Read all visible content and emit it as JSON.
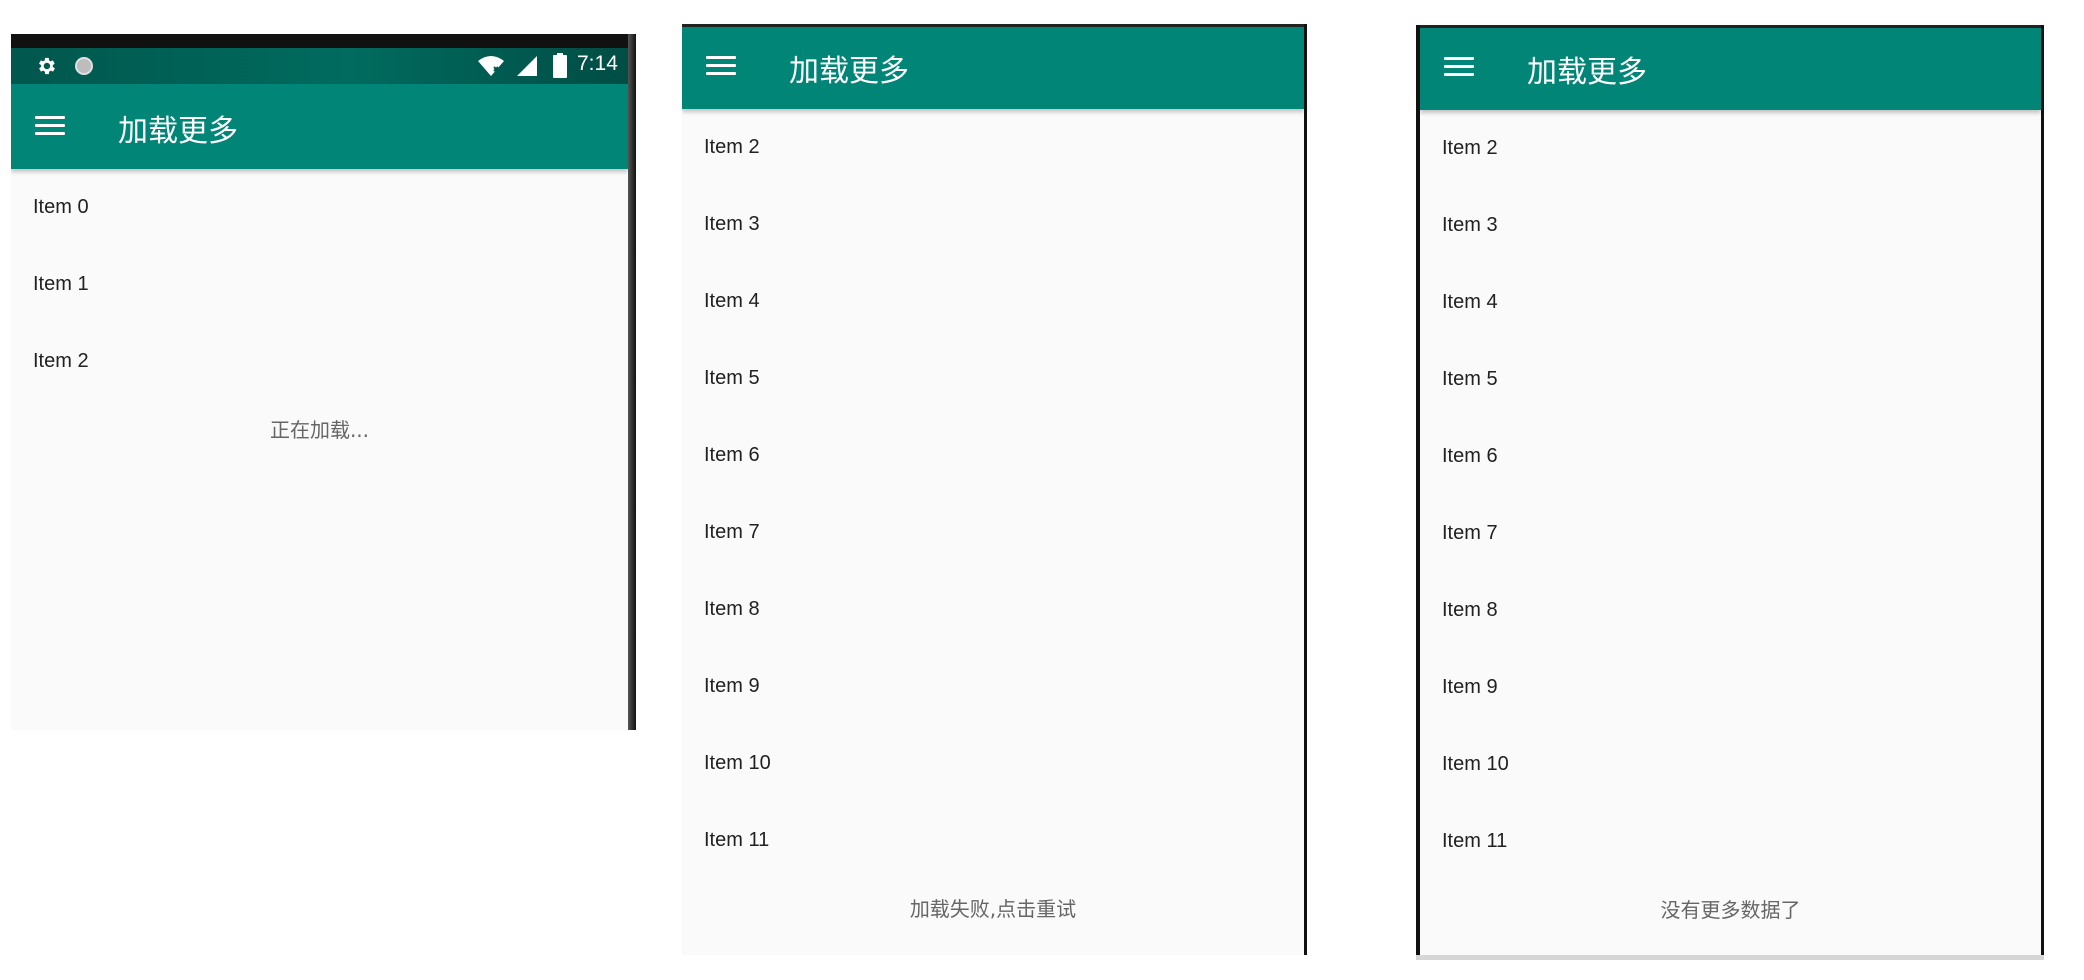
{
  "colors": {
    "primary": "#008577",
    "status_bar": "#00574d",
    "background": "#fafafa",
    "text_primary": "#212121",
    "text_secondary": "#666666"
  },
  "status_bar": {
    "time": "7:14",
    "icons": [
      "gear-icon",
      "circle-notification-icon",
      "wifi-icon",
      "signal-icon",
      "battery-icon"
    ]
  },
  "panels": [
    {
      "toolbar_title": "加载更多",
      "menu_icon": "hamburger-menu-icon",
      "items": [
        "Item 0",
        "Item 1",
        "Item 2"
      ],
      "footer": "正在加载..."
    },
    {
      "toolbar_title": "加载更多",
      "menu_icon": "hamburger-menu-icon",
      "items": [
        "Item 2",
        "Item 3",
        "Item 4",
        "Item 5",
        "Item 6",
        "Item 7",
        "Item 8",
        "Item 9",
        "Item 10",
        "Item 11"
      ],
      "footer": "加载失败,点击重试"
    },
    {
      "toolbar_title": "加载更多",
      "menu_icon": "hamburger-menu-icon",
      "items": [
        "Item 2",
        "Item 3",
        "Item 4",
        "Item 5",
        "Item 6",
        "Item 7",
        "Item 8",
        "Item 9",
        "Item 10",
        "Item 11"
      ],
      "footer": "没有更多数据了"
    }
  ]
}
